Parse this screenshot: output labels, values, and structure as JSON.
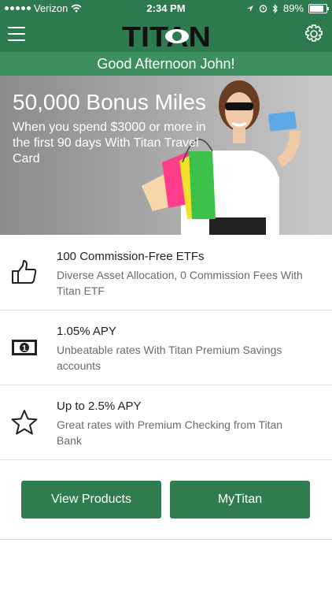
{
  "status_bar": {
    "carrier": "Verizon",
    "time": "2:34 PM",
    "battery": "89%"
  },
  "header": {
    "logo_text": "TITAN",
    "greeting": "Good Afternoon John!"
  },
  "banner": {
    "headline": "50,000 Bonus Miles",
    "subtext": "When you spend $3000 or more in the first 90 days With Titan Travel Card"
  },
  "features": [
    {
      "title": "100 Commission-Free ETFs",
      "description": "Diverse Asset Allocation, 0 Commission Fees With Titan ETF",
      "icon": "thumbs-up-icon"
    },
    {
      "title": "1.05% APY",
      "description": "Unbeatable rates With Titan Premium Savings accounts",
      "icon": "cash-icon"
    },
    {
      "title": "Up to 2.5% APY",
      "description": "Great rates with Premium Checking from Titan Bank",
      "icon": "star-icon"
    }
  ],
  "buttons": {
    "view_products": "View Products",
    "mytitan": "MyTitan"
  },
  "colors": {
    "brand_green": "#2d7a4f",
    "greeting_green": "#3d8f5d",
    "button_green": "#2f7d4f"
  }
}
